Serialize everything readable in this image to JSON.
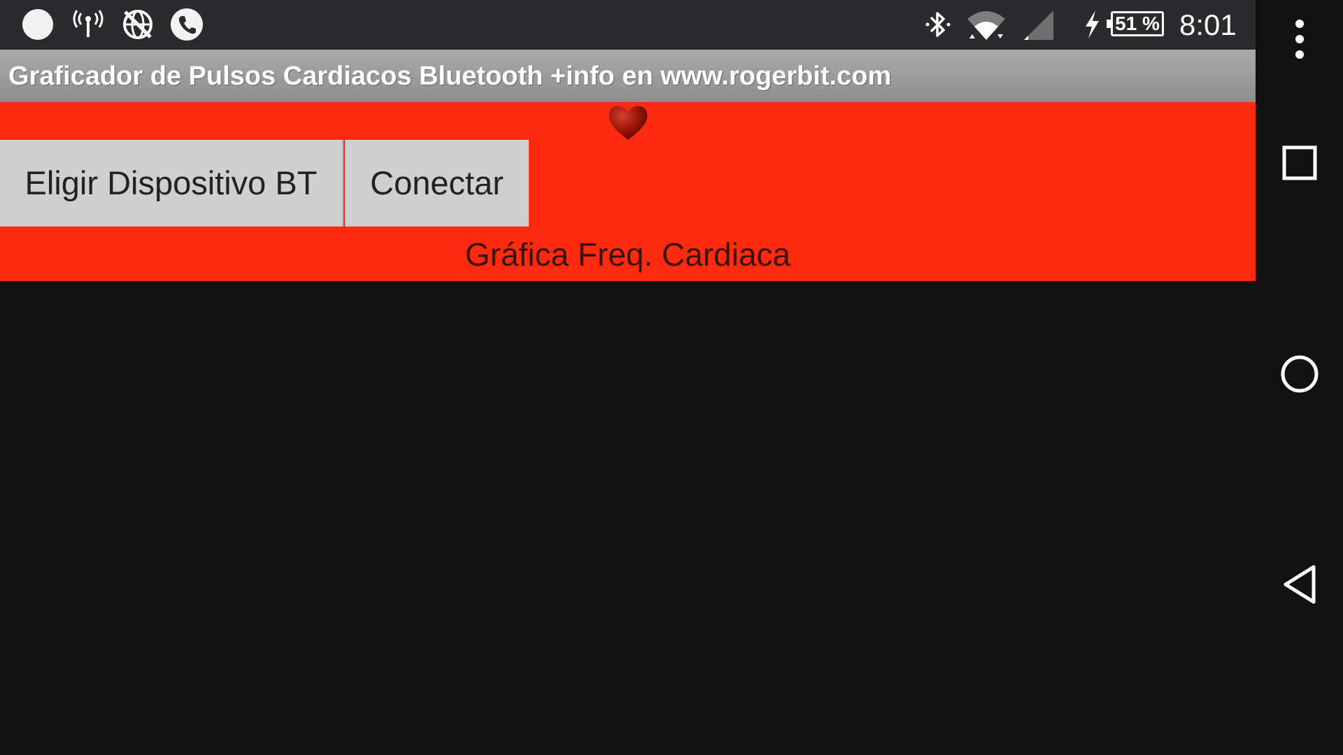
{
  "status_bar": {
    "left_icons": [
      "notification-dot-icon",
      "antenna-icon",
      "no-network-globe-icon",
      "phone-icon"
    ],
    "right_icons": [
      "bluetooth-icon",
      "wifi-icon",
      "cell-signal-icon",
      "charging-icon"
    ],
    "battery_percent": "51 %",
    "time": "8:01"
  },
  "app": {
    "title": "Graficador de Pulsos Cardiacos Bluetooth +info en www.rogerbit.com",
    "choose_device_label": "Eligir Dispositivo BT",
    "connect_label": "Conectar",
    "graph_label": "Gráfica Freq. Cardiaca",
    "heart_icon": "heart-icon"
  },
  "navigation": {
    "icons": [
      "more-vert-icon",
      "recents-square-icon",
      "home-circle-icon",
      "back-triangle-icon"
    ]
  },
  "colors": {
    "content_background": "#ff2a10",
    "button_background": "#cfcfcf",
    "title_bar": "#9a9a9a",
    "status_bar": "#2b2b2d",
    "graph_background": "#121212"
  }
}
